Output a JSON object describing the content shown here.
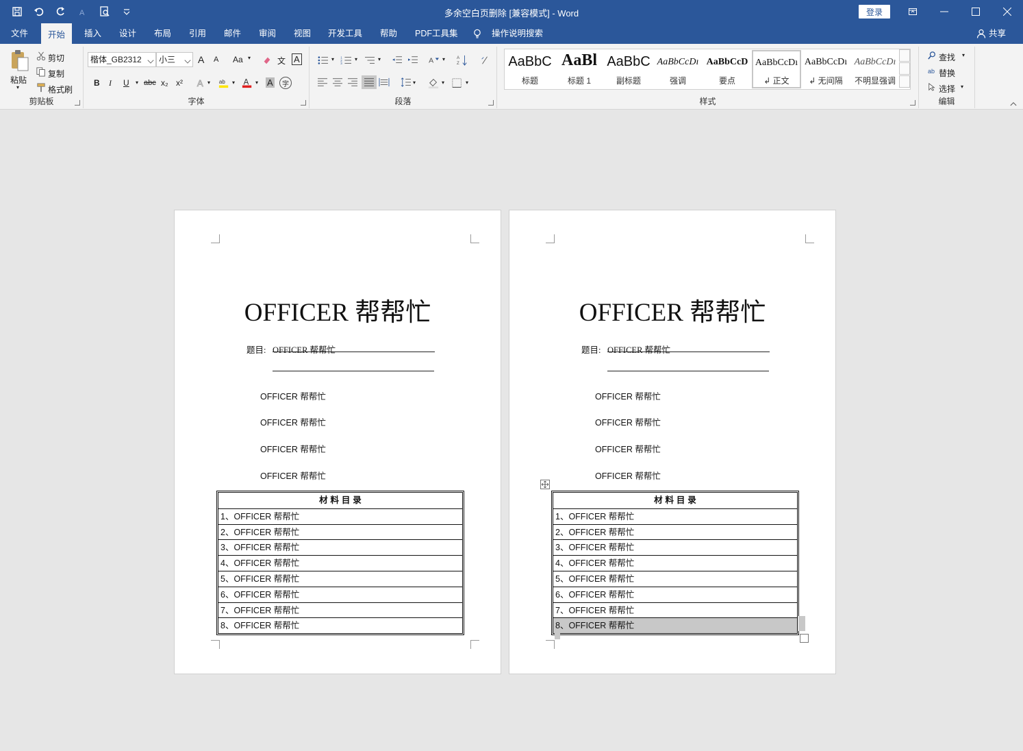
{
  "window": {
    "title": "多余空白页删除 [兼容模式]  -  Word",
    "login_label": "登录"
  },
  "tabs": [
    "文件",
    "开始",
    "插入",
    "设计",
    "布局",
    "引用",
    "邮件",
    "审阅",
    "视图",
    "开发工具",
    "帮助",
    "PDF工具集"
  ],
  "active_tab": "开始",
  "tell_me": "操作说明搜索",
  "share_label": "共享",
  "ribbon": {
    "clipboard": {
      "label": "剪贴板",
      "paste": "粘贴",
      "cut": "剪切",
      "copy": "复制",
      "format_painter": "格式刷"
    },
    "font": {
      "label": "字体",
      "font_name": "楷体_GB2312",
      "font_size": "小三",
      "bold": "B",
      "italic": "I",
      "underline": "U",
      "strike": "abc",
      "subscript": "x₂",
      "superscript": "x²",
      "grow": "A",
      "shrink": "A",
      "case": "Aa",
      "phonetic": "文",
      "border_char": "A",
      "char_shade": "A",
      "enclose": "字"
    },
    "paragraph": {
      "label": "段落"
    },
    "styles": {
      "label": "样式",
      "items": [
        {
          "sample": "AaBbC",
          "name": "标题"
        },
        {
          "sample": "AaBl",
          "name": "标题 1"
        },
        {
          "sample": "AaBbC",
          "name": "副标题"
        },
        {
          "sample": "AaBbCcDı",
          "name": "强调"
        },
        {
          "sample": "AaBbCcD",
          "name": "要点"
        },
        {
          "sample": "AaBbCcDı",
          "name": "↲ 正文"
        },
        {
          "sample": "AaBbCcDı",
          "name": "↲ 无间隔"
        },
        {
          "sample": "AaBbCcDı",
          "name": "不明显强调"
        }
      ],
      "selected_index": 5
    },
    "editing": {
      "label": "编辑",
      "find": "查找",
      "replace": "替换",
      "select": "选择"
    }
  },
  "pages": [
    {
      "heading": "OFFICER 帮帮忙",
      "subject_label": "题目:",
      "subject_value": "OFFICER 帮帮忙",
      "paragraphs": [
        "OFFICER 帮帮忙",
        "OFFICER 帮帮忙",
        "OFFICER 帮帮忙",
        "OFFICER 帮帮忙"
      ],
      "toc_title": "材    料    目    录",
      "toc_rows": [
        "1、OFFICER 帮帮忙",
        "2、OFFICER 帮帮忙",
        "3、OFFICER 帮帮忙",
        "4、OFFICER 帮帮忙",
        "5、OFFICER 帮帮忙",
        "6、OFFICER 帮帮忙",
        "7、OFFICER 帮帮忙",
        "8、OFFICER 帮帮忙"
      ]
    },
    {
      "heading": "OFFICER 帮帮忙",
      "subject_label": "题目:",
      "subject_value": "OFFICER 帮帮忙",
      "paragraphs": [
        "OFFICER 帮帮忙",
        "OFFICER 帮帮忙",
        "OFFICER 帮帮忙",
        "OFFICER 帮帮忙"
      ],
      "toc_title": "材    料    目    录",
      "toc_rows": [
        "1、OFFICER 帮帮忙",
        "2、OFFICER 帮帮忙",
        "3、OFFICER 帮帮忙",
        "4、OFFICER 帮帮忙",
        "5、OFFICER 帮帮忙",
        "6、OFFICER 帮帮忙",
        "7、OFFICER 帮帮忙",
        "8、OFFICER 帮帮忙"
      ],
      "selected_row": 7
    }
  ]
}
